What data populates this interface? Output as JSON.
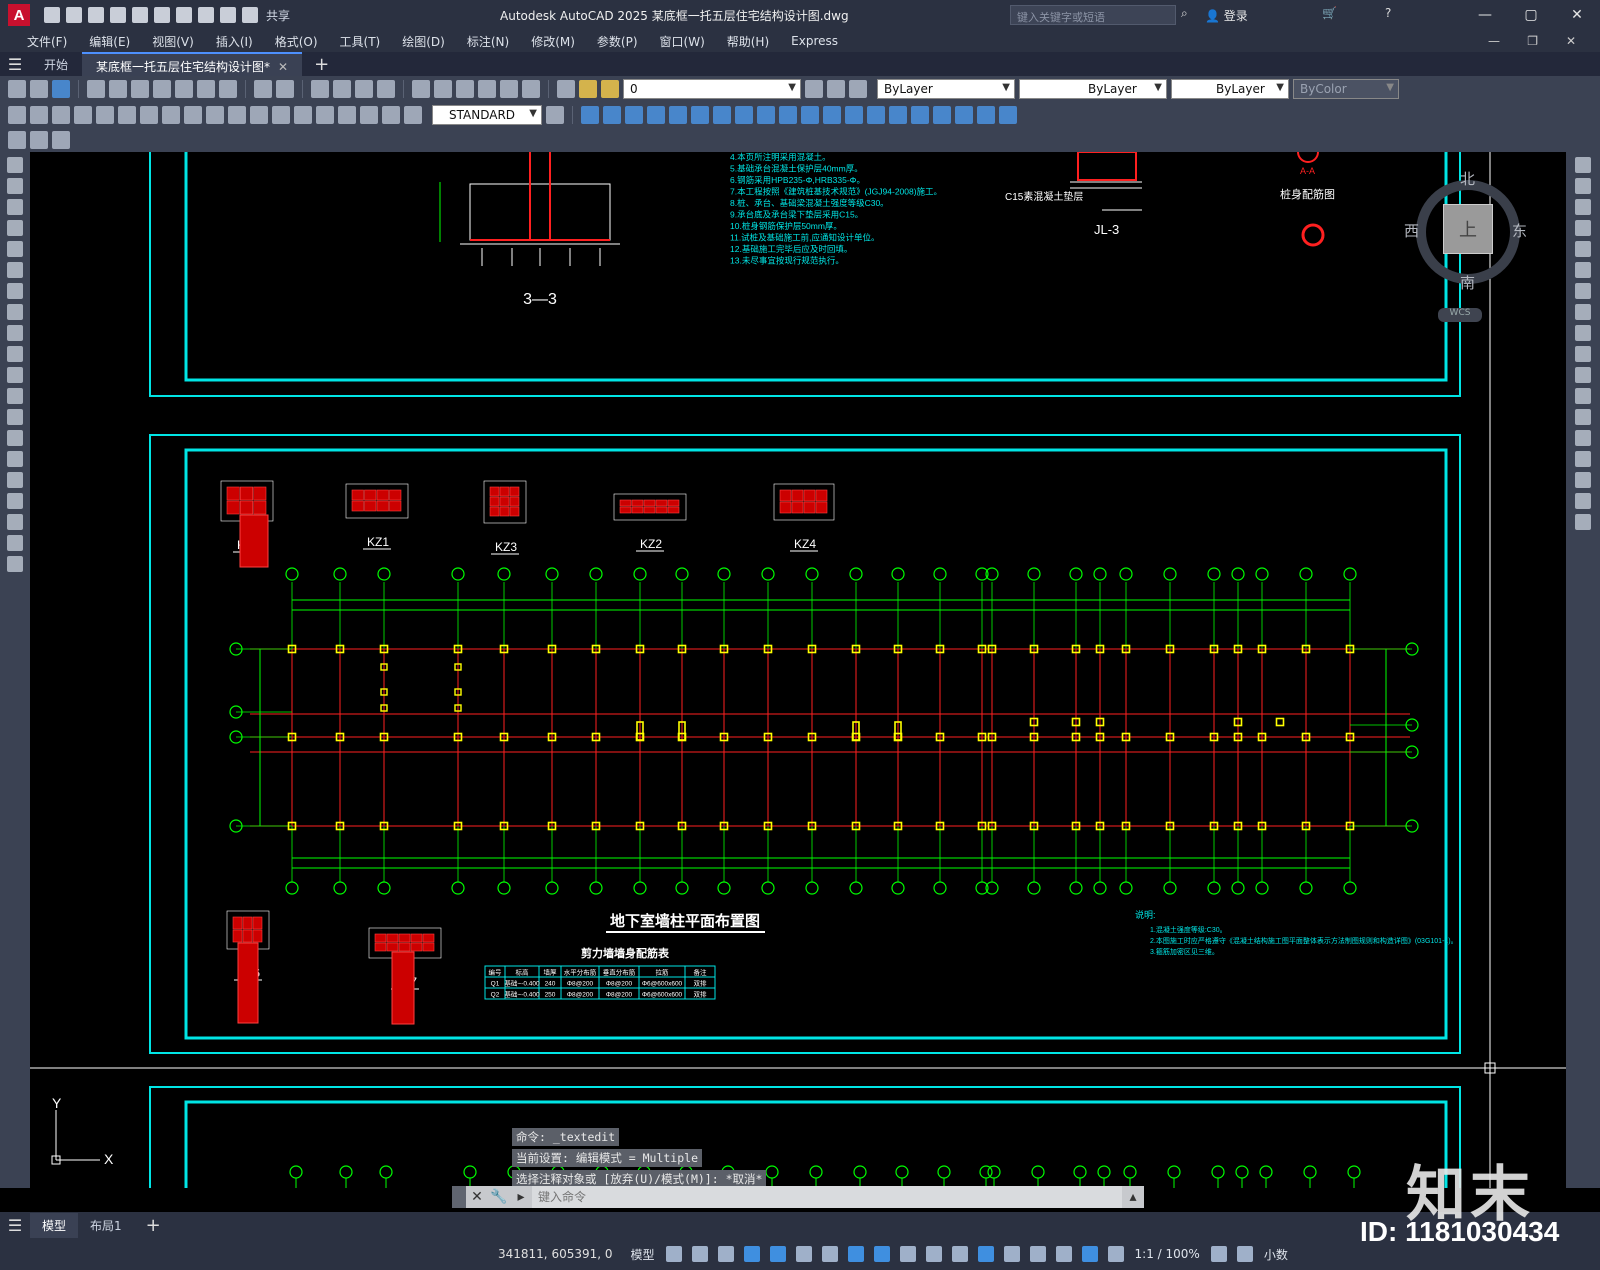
{
  "app": {
    "logo_letter": "A",
    "share_label": "共享",
    "window_title": "Autodesk AutoCAD 2025    某底框一托五层住宅结构设计图.dwg",
    "search_placeholder": "键入关键字或短语",
    "login_label": "登录"
  },
  "menu": [
    "文件(F)",
    "编辑(E)",
    "视图(V)",
    "插入(I)",
    "格式(O)",
    "工具(T)",
    "绘图(D)",
    "标注(N)",
    "修改(M)",
    "参数(P)",
    "窗口(W)",
    "帮助(H)",
    "Express"
  ],
  "tabs": {
    "start": "开始",
    "active_doc": "某底框一托五层住宅结构设计图*"
  },
  "toolbar": {
    "layer_value": "0",
    "text_style": "STANDARD",
    "color_combo": "ByLayer",
    "linetype_combo": "ByLayer",
    "lineweight_combo": "ByLayer",
    "plotstyle_combo": "ByColor"
  },
  "viewcube": {
    "north": "北",
    "south": "南",
    "east": "东",
    "west": "西",
    "face": "上",
    "wcs": "WCS"
  },
  "drawing": {
    "colors": {
      "frame": "#00e5e5",
      "axis": "#00ff00",
      "column": "#ffff00",
      "beam": "#ff2020",
      "text": "#00e5e5",
      "white": "#ffffff"
    },
    "section_3_3": "3—3",
    "jl3_label": "JL-3",
    "c15_label": "C15素混凝土垫层",
    "pile_label": "桩身配筋图",
    "aa_label": "A-A",
    "notes_upper": [
      "4.本页所注明采用混凝土。",
      "5.基础承台混凝土保护层40mm厚。",
      "6.钢筋采用HPB235-Φ,HRB335-Φ。",
      "7.本工程按照《建筑桩基技术规范》(JGJ94-2008)施工。",
      "8.桩、承台、基础梁混凝土强度等级C30。",
      "9.承台底及承台梁下垫层采用C15。",
      "10.桩身钢筋保护层50mm厚。",
      "11.试桩及基础施工前,应通知设计单位。",
      "12.基础施工完毕后应及时回填。",
      "13.未尽事宜按现行规范执行。"
    ],
    "col_labels_top": [
      "KZ5",
      "KZ1",
      "KZ3",
      "KZ2",
      "KZ4"
    ],
    "col_labels_bottom": [
      "KZ6",
      "KZ7"
    ],
    "plan_title": "地下室墙柱平面布置图",
    "shear_table_title": "剪力墙墙身配筋表",
    "shear_table_headers": [
      "编号",
      "标高",
      "墙厚",
      "水平分布筋",
      "垂直分布筋",
      "拉筋",
      "备注"
    ],
    "shear_table_rows": [
      [
        "Q1",
        "基础~-0.400",
        "240",
        "Φ8@200",
        "Φ8@200",
        "Φ6@600x600",
        "双排"
      ],
      [
        "Q2",
        "基础~-0.400",
        "250",
        "Φ8@200",
        "Φ8@200",
        "Φ6@600x600",
        "双排"
      ]
    ],
    "notes_title": "说明:",
    "notes_right": [
      "1.混凝土强度等级:C30。",
      "2.本图施工时应严格遵守《混凝土结构施工图平面整体表示方法制图规则和构造详图》(03G101-1)。",
      "3.箍筋加密区见三维。"
    ]
  },
  "command": {
    "history": [
      "命令: _textedit",
      "当前设置: 编辑模式 = Multiple",
      "选择注释对象或 [放弃(U)/模式(M)]: *取消*"
    ],
    "input_placeholder": "键入命令"
  },
  "layouts": {
    "model": "模型",
    "layout1": "布局1"
  },
  "status": {
    "coords": "341811, 605391, 0",
    "model_label": "模型",
    "scale": "1:1 / 100%",
    "units": "小数"
  },
  "watermark": {
    "logo": "知末",
    "id": "ID: 1181030434"
  }
}
